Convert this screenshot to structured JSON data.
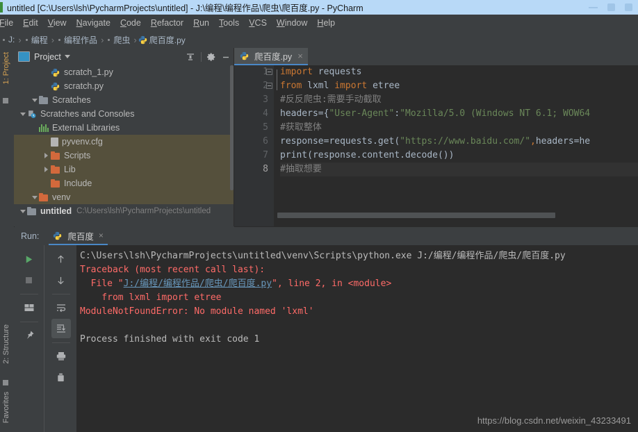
{
  "window": {
    "title": "untitled [C:\\Users\\lsh\\PycharmProjects\\untitled] - J:\\编程\\编程作品\\爬虫\\爬百度.py - PyCharm",
    "accent_color": "#b8d9f7",
    "ide_name": "PyCharm"
  },
  "menubar": {
    "items": [
      {
        "label": "File"
      },
      {
        "label": "Edit"
      },
      {
        "label": "View"
      },
      {
        "label": "Navigate"
      },
      {
        "label": "Code"
      },
      {
        "label": "Refactor"
      },
      {
        "label": "Run"
      },
      {
        "label": "Tools"
      },
      {
        "label": "VCS"
      },
      {
        "label": "Window"
      },
      {
        "label": "Help"
      }
    ]
  },
  "breadcrumb": {
    "items": [
      "J:",
      "编程",
      "编程作品",
      "爬虫",
      "爬百度.py"
    ],
    "separator": "›",
    "file_icon": "python-file-icon"
  },
  "left_tool_strip": {
    "top_label": "1: Project",
    "bottom_labels": [
      "2: Structure",
      "Favorites"
    ]
  },
  "project_panel": {
    "title": "Project",
    "header_icon": "project-view-icon",
    "buttons": [
      {
        "name": "collapse-all-icon",
        "label": "Collapse All"
      },
      {
        "name": "gear-icon",
        "label": "Settings"
      },
      {
        "name": "hide-icon",
        "label": "Hide"
      }
    ],
    "tree": [
      {
        "label": "untitled",
        "path": "C:\\Users\\lsh\\PycharmProjects\\untitled",
        "icon": "folder-grey",
        "indent": 0,
        "toggle": "down",
        "bold": true,
        "highlight": false
      },
      {
        "label": "venv",
        "path": "",
        "icon": "folder-orange",
        "indent": 1,
        "toggle": "down",
        "bold": false,
        "highlight": true
      },
      {
        "label": "Include",
        "path": "",
        "icon": "folder-orange",
        "indent": 2,
        "toggle": "none",
        "bold": false,
        "highlight": true
      },
      {
        "label": "Lib",
        "path": "",
        "icon": "folder-orange",
        "indent": 2,
        "toggle": "right",
        "bold": false,
        "highlight": true
      },
      {
        "label": "Scripts",
        "path": "",
        "icon": "folder-orange",
        "indent": 2,
        "toggle": "right",
        "bold": false,
        "highlight": true
      },
      {
        "label": "pyvenv.cfg",
        "path": "",
        "icon": "config-file",
        "indent": 2,
        "toggle": "none",
        "bold": false,
        "highlight": true
      },
      {
        "label": "External Libraries",
        "path": "",
        "icon": "libraries",
        "indent": 1,
        "toggle": "none",
        "bold": false,
        "highlight": false
      },
      {
        "label": "Scratches and Consoles",
        "path": "",
        "icon": "scratches-root",
        "indent": 0,
        "toggle": "down",
        "bold": false,
        "highlight": false
      },
      {
        "label": "Scratches",
        "path": "",
        "icon": "folder-grey",
        "indent": 1,
        "toggle": "down",
        "bold": false,
        "highlight": false
      },
      {
        "label": "scratch.py",
        "path": "",
        "icon": "python-file-icon",
        "indent": 2,
        "toggle": "none",
        "bold": false,
        "highlight": false
      },
      {
        "label": "scratch_1.py",
        "path": "",
        "icon": "python-file-icon",
        "indent": 2,
        "toggle": "none",
        "bold": false,
        "highlight": false
      }
    ]
  },
  "editor": {
    "tabs": [
      {
        "label": "爬百度.py",
        "icon": "python-file-icon",
        "active": true,
        "close": "×"
      }
    ],
    "current_line": 8,
    "lines": [
      {
        "no": "1",
        "fold": "start",
        "tokens": [
          {
            "t": "import",
            "c": "kw"
          },
          {
            "t": " requests",
            "c": "pln"
          }
        ]
      },
      {
        "no": "2",
        "fold": "end",
        "tokens": [
          {
            "t": "from",
            "c": "kw"
          },
          {
            "t": " lxml ",
            "c": "pln"
          },
          {
            "t": "import",
            "c": "kw"
          },
          {
            "t": " etree",
            "c": "pln"
          }
        ]
      },
      {
        "no": "3",
        "fold": "none",
        "tokens": [
          {
            "t": "#反反爬虫:需要手动截取",
            "c": "cmt"
          }
        ]
      },
      {
        "no": "4",
        "fold": "none",
        "tokens": [
          {
            "t": "headers={",
            "c": "pln"
          },
          {
            "t": "\"User-Agent\"",
            "c": "str"
          },
          {
            "t": ":",
            "c": "pln"
          },
          {
            "t": "\"Mozilla/5.0 (Windows NT 6.1; WOW64",
            "c": "str"
          }
        ]
      },
      {
        "no": "5",
        "fold": "none",
        "tokens": [
          {
            "t": "#获取整体",
            "c": "cmt"
          }
        ]
      },
      {
        "no": "6",
        "fold": "none",
        "tokens": [
          {
            "t": "response=requests.get(",
            "c": "pln"
          },
          {
            "t": "\"https://www.baidu.com/\"",
            "c": "str"
          },
          {
            "t": ",",
            "c": "comma"
          },
          {
            "t": "headers=he",
            "c": "pln"
          }
        ]
      },
      {
        "no": "7",
        "fold": "none",
        "tokens": [
          {
            "t": "print(response.content.decode())",
            "c": "pln"
          }
        ]
      },
      {
        "no": "8",
        "fold": "none",
        "tokens": [
          {
            "t": "#抽取想要",
            "c": "cmt"
          }
        ]
      }
    ]
  },
  "run_panel": {
    "label": "Run:",
    "tab": {
      "label": "爬百度",
      "icon": "python-file-icon",
      "close": "×"
    },
    "toolbar_left": [
      {
        "name": "rerun-icon",
        "label": "Rerun"
      },
      {
        "name": "stop-icon",
        "label": "Stop"
      },
      {
        "name": "layout-icon",
        "label": "Layout"
      },
      {
        "name": "pin-icon",
        "label": "Pin Tab"
      }
    ],
    "toolbar_right": [
      {
        "name": "up-arrow-icon",
        "label": "Previous Occurrence"
      },
      {
        "name": "down-arrow-icon",
        "label": "Next Occurrence"
      },
      {
        "name": "soft-wrap-icon",
        "label": "Soft-Wrap"
      },
      {
        "name": "scroll-to-end-icon",
        "label": "Scroll to End"
      },
      {
        "name": "print-icon",
        "label": "Print"
      },
      {
        "name": "trash-icon",
        "label": "Clear All"
      }
    ],
    "console": {
      "lines": [
        {
          "segments": [
            {
              "t": "C:\\Users\\lsh\\PycharmProjects\\untitled\\venv\\Scripts\\python.exe J:/编程/编程作品/爬虫/爬百度.py",
              "c": "c-white"
            }
          ]
        },
        {
          "segments": [
            {
              "t": "Traceback (most recent call last):",
              "c": "c-red"
            }
          ]
        },
        {
          "segments": [
            {
              "t": "  File \"",
              "c": "c-red"
            },
            {
              "t": "J:/编程/编程作品/爬虫/爬百度.py",
              "c": "c-link"
            },
            {
              "t": "\", line 2, in <module>",
              "c": "c-red"
            }
          ]
        },
        {
          "segments": [
            {
              "t": "    from lxml import etree",
              "c": "c-red"
            }
          ]
        },
        {
          "segments": [
            {
              "t": "ModuleNotFoundError: No module named 'lxml'",
              "c": "c-red"
            }
          ]
        },
        {
          "segments": [
            {
              "t": "",
              "c": "c-white"
            }
          ]
        },
        {
          "segments": [
            {
              "t": "Process finished with exit code 1",
              "c": "c-white"
            }
          ]
        }
      ]
    }
  },
  "watermark": {
    "text": "https://blog.csdn.net/weixin_43233491"
  }
}
